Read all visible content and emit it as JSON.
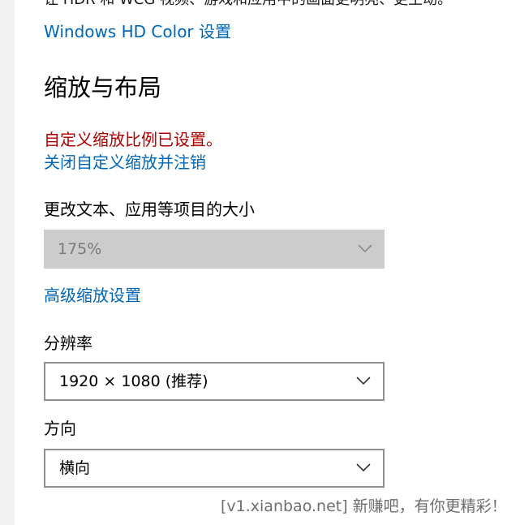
{
  "hdr": {
    "description": "让 HDR 和 WCG 视频、游戏和应用中的画面更明亮、更生动。",
    "hd_color_link": "Windows HD Color 设置"
  },
  "scale_layout": {
    "title": "缩放与布局",
    "custom_warning": "自定义缩放比例已设置。",
    "disable_custom_link": "关闭自定义缩放并注销",
    "size_label": "更改文本、应用等项目的大小",
    "size_value": "175%",
    "advanced_link": "高级缩放设置",
    "resolution_label": "分辨率",
    "resolution_value": "1920 × 1080 (推荐)",
    "orientation_label": "方向",
    "orientation_value": "横向"
  },
  "watermark": "[v1.xianbao.net] 新赚吧，有你更精彩！",
  "colors": {
    "link": "#0067b8",
    "warning": "#b00000",
    "disabled_bg": "#cccccc",
    "dropdown_border": "#8f8f8f"
  },
  "icons": {
    "dropdown": "chevron-down-icon"
  }
}
